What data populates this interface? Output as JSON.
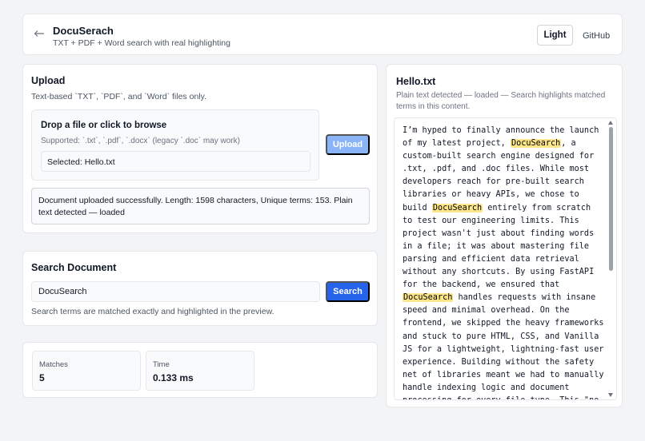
{
  "header": {
    "title": "DocuSerach",
    "subtitle": "TXT + PDF + Word search with real highlighting",
    "theme_button": "Light",
    "github_link": "GitHub"
  },
  "upload": {
    "title": "Upload",
    "subtitle": "Text-based `TXT`, `PDF`, and `Word` files only.",
    "dropzone_title": "Drop a file or click to browse",
    "dropzone_supported": "Supported: `.txt`, `.pdf`, `.docx` (legacy `.doc` may work)",
    "selected": "Selected: Hello.txt",
    "upload_button": "Upload",
    "status": "Document uploaded successfully. Length: 1598 characters, Unique terms: 153. Plain text detected — loaded"
  },
  "search": {
    "title": "Search Document",
    "input_value": "DocuSearch",
    "button": "Search",
    "hint": "Search terms are matched exactly and highlighted in the preview."
  },
  "stats": {
    "matches_label": "Matches",
    "matches_value": "5",
    "time_label": "Time",
    "time_value": "0.133 ms"
  },
  "preview": {
    "title": "Hello.txt",
    "subtitle": "Plain text detected — loaded — Search highlights matched terms in this content.",
    "segments": [
      "I’m hyped to finally announce the launch of my latest project, ",
      "DocuSearch",
      ", a custom-built search engine designed for .txt, .pdf, and .doc files. While most developers reach for pre-built search libraries or heavy APIs, we chose to build ",
      "DocuSearch",
      " entirely from scratch to test our engineering limits. This project wasn't just about finding words in a file; it was about mastering file parsing and efficient data retrieval without any shortcuts. By using FastAPI for the backend, we ensured that ",
      "DocuSearch",
      " handles requests with insane speed and minimal overhead. On the frontend, we skipped the heavy frameworks and stuck to pure HTML, CSS, and Vanilla JS for a lightweight, lightning-fast user experience. Building without the safety net of libraries meant we had to manually handle indexing logic and document processing for every file type. This \"no-library\" approach forced us to"
    ]
  },
  "colors": {
    "accent": "#2563eb",
    "upload_disabled": "#8ab4f8",
    "highlight": "#fde68a"
  }
}
